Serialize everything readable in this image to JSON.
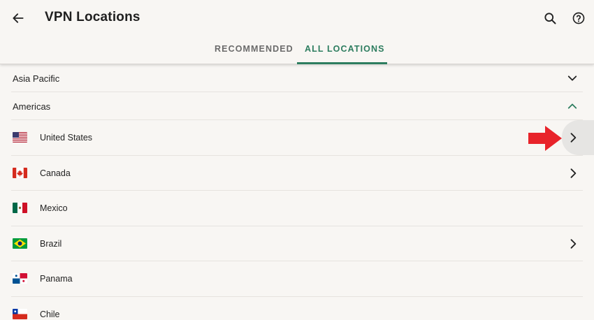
{
  "header": {
    "title": "VPN Locations",
    "back_icon": "arrow-left-icon",
    "search_icon": "search-icon",
    "help_icon": "help-circle-icon"
  },
  "tabs": [
    {
      "label": "RECOMMENDED",
      "active": false
    },
    {
      "label": "ALL LOCATIONS",
      "active": true
    }
  ],
  "colors": {
    "accent": "#2d7d5f",
    "background": "#f8f6f3",
    "divider": "#e6e3df",
    "annotation_arrow": "#e8232a"
  },
  "sections": [
    {
      "label": "Asia Pacific",
      "expanded": false,
      "chevron": "chevron-down-icon"
    },
    {
      "label": "Americas",
      "expanded": true,
      "chevron": "chevron-up-icon"
    }
  ],
  "countries": [
    {
      "name": "United States",
      "flag": "us-flag-icon",
      "has_sublocations": true,
      "highlighted": true
    },
    {
      "name": "Canada",
      "flag": "canada-flag-icon",
      "has_sublocations": true,
      "highlighted": false
    },
    {
      "name": "Mexico",
      "flag": "mexico-flag-icon",
      "has_sublocations": false,
      "highlighted": false
    },
    {
      "name": "Brazil",
      "flag": "brazil-flag-icon",
      "has_sublocations": true,
      "highlighted": false
    },
    {
      "name": "Panama",
      "flag": "panama-flag-icon",
      "has_sublocations": false,
      "highlighted": false
    },
    {
      "name": "Chile",
      "flag": "chile-flag-icon",
      "has_sublocations": false,
      "highlighted": false
    }
  ]
}
